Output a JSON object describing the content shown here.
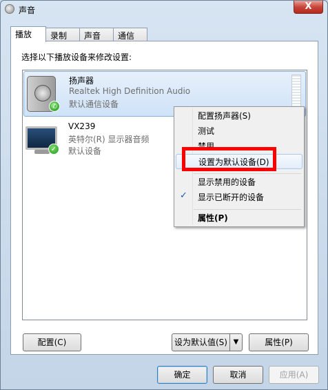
{
  "window": {
    "title": "声音",
    "close_label": "X"
  },
  "tabs": [
    {
      "label": "播放"
    },
    {
      "label": "录制"
    },
    {
      "label": "声音"
    },
    {
      "label": "通信"
    }
  ],
  "instruction": "选择以下播放设备来修改设置:",
  "devices": [
    {
      "name": "扬声器",
      "desc": "Realtek High Definition Audio",
      "status": "默认通信设备",
      "icon": "speaker-icon",
      "badge": "phone-badge-icon"
    },
    {
      "name": "VX239",
      "desc": "英特尔(R) 显示器音频",
      "status": "默认设备",
      "icon": "monitor-icon",
      "badge": "checkmark-badge-icon"
    }
  ],
  "context_menu": [
    {
      "label": "配置扬声器(S)"
    },
    {
      "label": "测试"
    },
    {
      "label": "禁用"
    },
    {
      "label": "设置为默认设备(D)"
    },
    {
      "label": "显示禁用的设备"
    },
    {
      "label": "显示已断开的设备",
      "checked": true
    },
    {
      "label": "属性(P)"
    }
  ],
  "buttons": {
    "configure": "配置(C)",
    "set_default": "设为默认值(S)",
    "properties": "属性(P)",
    "ok": "确定",
    "cancel": "取消",
    "apply": "应用(A)"
  },
  "colors": {
    "highlight_box": "#ff0000",
    "selection": "#cfe2f7"
  }
}
